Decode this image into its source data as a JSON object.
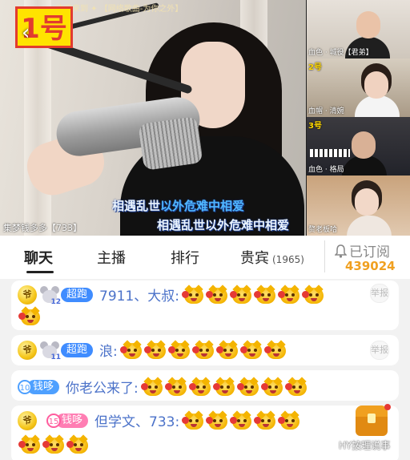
{
  "stream": {
    "room_badge": "1号",
    "top_overlay": "欢迎来到 ✦ 【网络歌曲-为你之外】",
    "lyric_line_1_a": "相遇乱世",
    "lyric_line_1_b": "以外危难中相爱",
    "lyric_line_2": "相遇乱世以外危难中相爱",
    "bottom_user_tag": "集梦钱多多【733】",
    "side_videos": [
      {
        "number": "",
        "label": "血色 · 城役【君弟】"
      },
      {
        "number": "2号",
        "label": "血帽 · 清婉"
      },
      {
        "number": "3号",
        "label": "血色 · 格局"
      },
      {
        "number": "",
        "label": "赘老板哈"
      }
    ]
  },
  "tabs": {
    "items": [
      "聊天",
      "主播",
      "排行",
      "贵宾"
    ],
    "guest_count": "(1965)",
    "subscribe_label": "已订阅",
    "subscribe_count": "439024"
  },
  "chat": {
    "messages": [
      {
        "level": "爷",
        "badge": "超跑",
        "badge_level": "12",
        "user": "7911、大叔:",
        "emoji_count": 7
      },
      {
        "level": "爷",
        "badge": "超跑",
        "badge_level": "11",
        "user": "浪:",
        "emoji_count": 7
      },
      {
        "fan_num": "10",
        "badge": "钱哆",
        "user": "你老公来了:",
        "emoji_count": 7
      },
      {
        "level": "爷",
        "fan_num": "15",
        "badge": "钱哆",
        "user": "但学文、733:",
        "emoji_count": 8
      }
    ],
    "report_label": "举报",
    "watermark": "HY按理说事"
  },
  "colors": {
    "accent_blue": "#3f8cff",
    "name_blue": "#4b72c9",
    "subscribe_orange": "#f0a020",
    "badge_yellow": "#ffe300",
    "badge_red": "#e23b2f"
  },
  "icons": [
    "back-arrow-icon",
    "bell-icon",
    "level-crown-icon",
    "mouse-badge-icon",
    "cat-emoji-icon",
    "treasure-chest-icon",
    "report-icon"
  ]
}
